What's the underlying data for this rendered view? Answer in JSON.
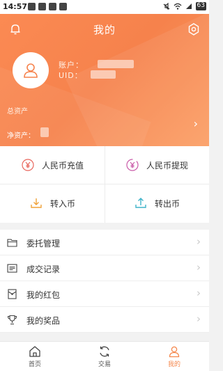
{
  "statusbar": {
    "time": "14:57",
    "battery": "63"
  },
  "header": {
    "title": "我的",
    "account_label": "账户：",
    "uid_label": "UID：",
    "total_assets_label": "总资产",
    "net_assets_label": "净资产："
  },
  "actions": {
    "rmb_deposit": "人民币充值",
    "rmb_withdraw": "人民币提现",
    "coin_in": "转入币",
    "coin_out": "转出币"
  },
  "menu": {
    "items": [
      {
        "label": "委托管理",
        "icon": "folder-icon"
      },
      {
        "label": "成交记录",
        "icon": "record-list-icon"
      },
      {
        "label": "我的红包",
        "icon": "red-packet-icon"
      },
      {
        "label": "我的奖品",
        "icon": "trophy-icon"
      }
    ]
  },
  "tabs": {
    "home": "首页",
    "trade": "交易",
    "mine": "我的"
  },
  "colors": {
    "accent": "#f6824c",
    "deposit_icon": "#e8655b",
    "withdraw_icon": "#c95aa8",
    "coin_in_icon": "#f0a23a",
    "coin_out_icon": "#3fb3c9"
  }
}
